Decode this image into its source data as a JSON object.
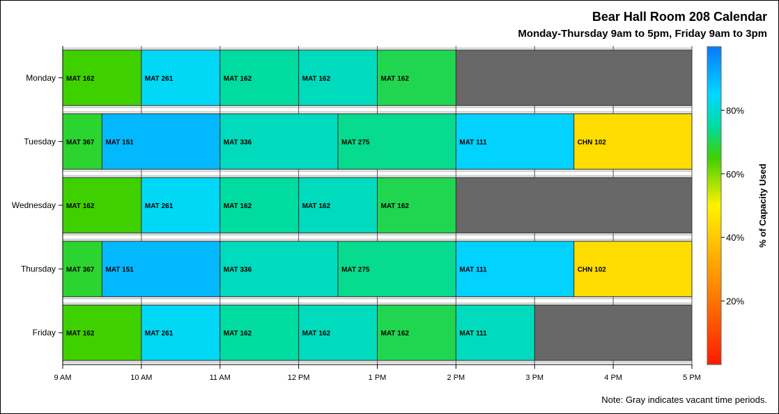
{
  "title": "Bear Hall Room 208 Calendar",
  "subtitle": "Monday-Thursday 9am to 5pm, Friday 9am to 3pm",
  "note": "Note: Gray indicates vacant time periods.",
  "colors": {
    "vacant_scheduled": "#686868",
    "vacant_after_hours": "#e6e6e6",
    "row_band": "#e6e6e6",
    "grid": "#555555"
  },
  "chart_data": {
    "type": "gantt",
    "x_tick_labels": [
      "9 AM",
      "10 AM",
      "11 AM",
      "12 PM",
      "1 PM",
      "2 PM",
      "3 PM",
      "4 PM",
      "5 PM"
    ],
    "x_range_hours": [
      9,
      17
    ],
    "days": [
      {
        "name": "Monday",
        "blocks": [
          {
            "label": "MAT 162",
            "start": 9,
            "end": 10,
            "capacity_pct": 65
          },
          {
            "label": "MAT 261",
            "start": 10,
            "end": 11,
            "capacity_pct": 84
          },
          {
            "label": "MAT 162",
            "start": 11,
            "end": 12,
            "capacity_pct": 75
          },
          {
            "label": "MAT 162",
            "start": 12,
            "end": 13,
            "capacity_pct": 78
          },
          {
            "label": "MAT 162",
            "start": 13,
            "end": 14,
            "capacity_pct": 70
          }
        ],
        "vacant": [
          {
            "start": 14,
            "end": 17
          }
        ]
      },
      {
        "name": "Tuesday",
        "blocks": [
          {
            "label": "MAT 367",
            "start": 9,
            "end": 9.5,
            "capacity_pct": 68
          },
          {
            "label": "MAT 151",
            "start": 9.5,
            "end": 11,
            "capacity_pct": 90
          },
          {
            "label": "MAT 336",
            "start": 11,
            "end": 12.5,
            "capacity_pct": 78
          },
          {
            "label": "MAT 275",
            "start": 12.5,
            "end": 14,
            "capacity_pct": 74
          },
          {
            "label": "MAT 111",
            "start": 14,
            "end": 15.5,
            "capacity_pct": 86
          },
          {
            "label": "CHN 102",
            "start": 15.5,
            "end": 17,
            "capacity_pct": 45
          }
        ],
        "vacant": []
      },
      {
        "name": "Wednesday",
        "blocks": [
          {
            "label": "MAT 162",
            "start": 9,
            "end": 10,
            "capacity_pct": 65
          },
          {
            "label": "MAT 261",
            "start": 10,
            "end": 11,
            "capacity_pct": 84
          },
          {
            "label": "MAT 162",
            "start": 11,
            "end": 12,
            "capacity_pct": 75
          },
          {
            "label": "MAT 162",
            "start": 12,
            "end": 13,
            "capacity_pct": 78
          },
          {
            "label": "MAT 162",
            "start": 13,
            "end": 14,
            "capacity_pct": 70
          }
        ],
        "vacant": [
          {
            "start": 14,
            "end": 17
          }
        ]
      },
      {
        "name": "Thursday",
        "blocks": [
          {
            "label": "MAT 367",
            "start": 9,
            "end": 9.5,
            "capacity_pct": 68
          },
          {
            "label": "MAT 151",
            "start": 9.5,
            "end": 11,
            "capacity_pct": 90
          },
          {
            "label": "MAT 336",
            "start": 11,
            "end": 12.5,
            "capacity_pct": 78
          },
          {
            "label": "MAT 275",
            "start": 12.5,
            "end": 14,
            "capacity_pct": 74
          },
          {
            "label": "MAT 111",
            "start": 14,
            "end": 15.5,
            "capacity_pct": 86
          },
          {
            "label": "CHN 102",
            "start": 15.5,
            "end": 17,
            "capacity_pct": 45
          }
        ],
        "vacant": []
      },
      {
        "name": "Friday",
        "blocks": [
          {
            "label": "MAT 162",
            "start": 9,
            "end": 10,
            "capacity_pct": 65
          },
          {
            "label": "MAT 261",
            "start": 10,
            "end": 11,
            "capacity_pct": 84
          },
          {
            "label": "MAT 162",
            "start": 11,
            "end": 12,
            "capacity_pct": 75
          },
          {
            "label": "MAT 162",
            "start": 12,
            "end": 13,
            "capacity_pct": 78
          },
          {
            "label": "MAT 162",
            "start": 13,
            "end": 14,
            "capacity_pct": 70
          },
          {
            "label": "MAT 111",
            "start": 14,
            "end": 15,
            "capacity_pct": 78
          }
        ],
        "vacant": [
          {
            "start": 15,
            "end": 17
          }
        ]
      }
    ],
    "colorbar": {
      "label": "% of Capacity Used",
      "range": [
        0,
        100
      ],
      "tick_labels": [
        "20%",
        "40%",
        "60%",
        "80%"
      ],
      "tick_values": [
        20,
        40,
        60,
        80
      ],
      "stops": [
        {
          "value": 0,
          "color": "#ff1a00"
        },
        {
          "value": 25,
          "color": "#ff8a00"
        },
        {
          "value": 50,
          "color": "#fff200"
        },
        {
          "value": 65,
          "color": "#3fd000"
        },
        {
          "value": 75,
          "color": "#00dca0"
        },
        {
          "value": 85,
          "color": "#00d8ff"
        },
        {
          "value": 100,
          "color": "#0a78ff"
        }
      ]
    }
  }
}
